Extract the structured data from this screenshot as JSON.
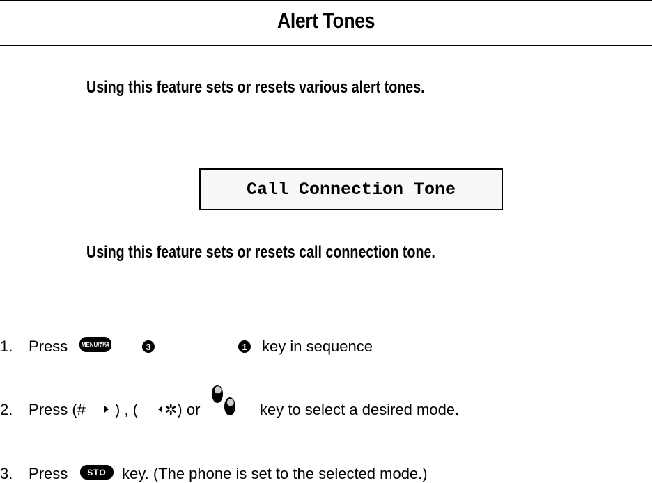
{
  "header": {
    "title": "Alert Tones"
  },
  "intro": {
    "text": "Using this feature sets or resets various alert tones."
  },
  "feature": {
    "name": "Call Connection Tone",
    "description": "Using this feature sets or resets call connection tone."
  },
  "steps": [
    {
      "number": "1.",
      "press": "Press",
      "key_menu": "MENU/한영",
      "key_a": "3",
      "key_b": "1",
      "rest": "key in sequence"
    },
    {
      "number": "2.",
      "press": "Press (#",
      "mid1": ") , (",
      "mid2": "✲) or",
      "rest": "key to select a desired mode."
    },
    {
      "number": "3.",
      "press": "Press",
      "key_sto": "STO",
      "rest": "key. (The phone is set to the selected mode.)"
    }
  ]
}
